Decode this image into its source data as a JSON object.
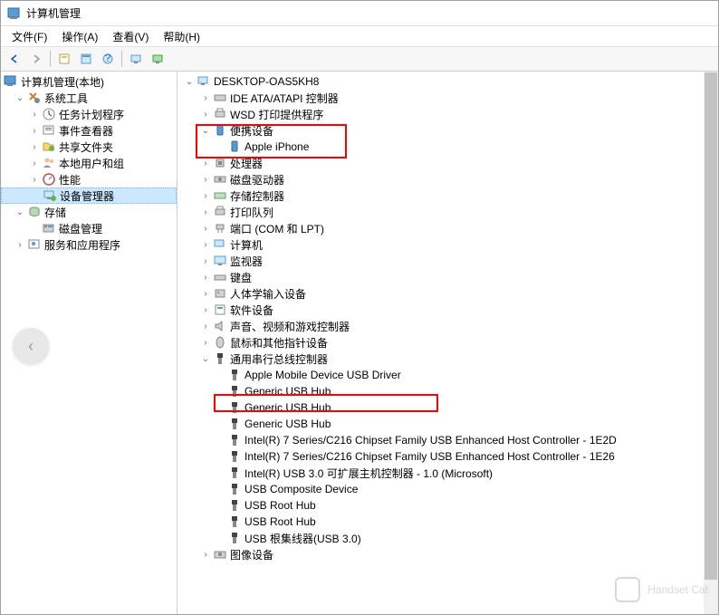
{
  "window": {
    "title": "计算机管理"
  },
  "menu": {
    "file": "文件(F)",
    "action": "操作(A)",
    "view": "查看(V)",
    "help": "帮助(H)"
  },
  "left_tree": {
    "root": "计算机管理(本地)",
    "system_tools": "系统工具",
    "task_scheduler": "任务计划程序",
    "event_viewer": "事件查看器",
    "shared_folders": "共享文件夹",
    "local_users": "本地用户和组",
    "performance": "性能",
    "device_manager": "设备管理器",
    "storage": "存储",
    "disk_mgmt": "磁盘管理",
    "services": "服务和应用程序"
  },
  "right_tree": {
    "root": "DESKTOP-OAS5KH8",
    "ide": "IDE ATA/ATAPI 控制器",
    "wsd": "WSD 打印提供程序",
    "portable": "便携设备",
    "iphone": "Apple iPhone",
    "processor": "处理器",
    "diskdrive": "磁盘驱动器",
    "storage_ctrl": "存储控制器",
    "print_queue": "打印队列",
    "ports": "端口 (COM 和 LPT)",
    "computer": "计算机",
    "monitor": "监视器",
    "keyboard": "键盘",
    "hid": "人体学输入设备",
    "software": "软件设备",
    "audio": "声音、视频和游戏控制器",
    "mouse": "鼠标和其他指针设备",
    "usb_controllers": "通用串行总线控制器",
    "usb": {
      "apple": "Apple Mobile Device USB Driver",
      "ghub1": "Generic USB Hub",
      "ghub2": "Generic USB Hub",
      "ghub3": "Generic USB Hub",
      "intel1": "Intel(R) 7 Series/C216 Chipset Family USB Enhanced Host Controller - 1E2D",
      "intel2": "Intel(R) 7 Series/C216 Chipset Family USB Enhanced Host Controller - 1E26",
      "intel3": "Intel(R) USB 3.0 可扩展主机控制器 - 1.0 (Microsoft)",
      "composite": "USB Composite Device",
      "roothub1": "USB Root Hub",
      "roothub2": "USB Root Hub",
      "roothub3": "USB 根集线器(USB 3.0)"
    },
    "imaging": "图像设备"
  },
  "watermark": "Handset Cat"
}
